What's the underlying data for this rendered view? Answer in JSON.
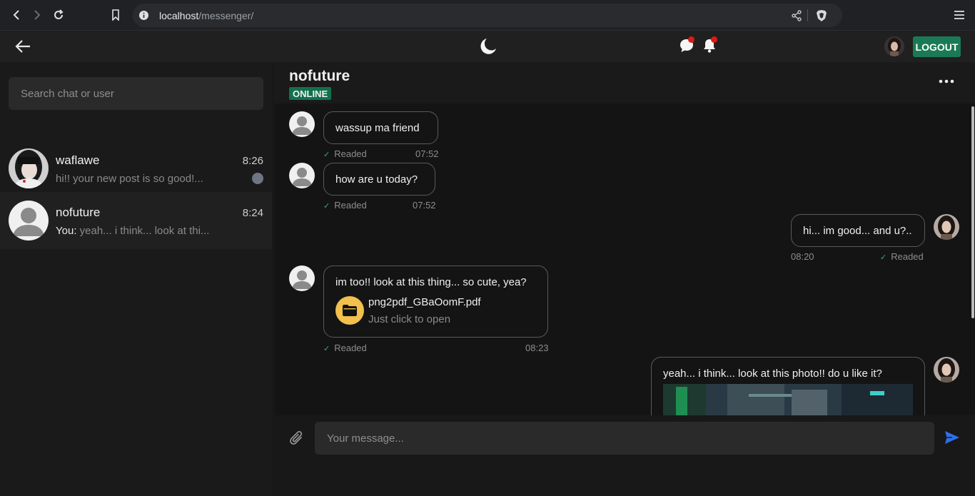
{
  "browser": {
    "url_host": "localhost",
    "url_path": "/messenger/"
  },
  "header": {
    "logout_label": "LOGOUT"
  },
  "sidebar": {
    "search_placeholder": "Search chat or user",
    "chats": [
      {
        "name": "waflawe",
        "time": "8:26",
        "preview": "hi!! your new post is so good!..."
      },
      {
        "name": "nofuture",
        "time": "8:24",
        "you_prefix": "You:",
        "preview": " yeah... i think... look at thi..."
      }
    ]
  },
  "conversation": {
    "name": "nofuture",
    "status": "ONLINE",
    "messages": [
      {
        "text": "wassup ma friend",
        "status": "Readed",
        "time": "07:52"
      },
      {
        "text": "how are u today?",
        "status": "Readed",
        "time": "07:52"
      },
      {
        "text": "hi... im good... and u?..",
        "status": "Readed",
        "time": "08:20"
      },
      {
        "text": "im too!! look at this thing... so cute, yea?",
        "file_name": "png2pdf_GBaOomF.pdf",
        "file_hint": "Just click to open",
        "status": "Readed",
        "time": "08:23"
      },
      {
        "text": "yeah... i think... look at this photo!! do u like it?"
      }
    ]
  },
  "composer": {
    "placeholder": "Your message..."
  },
  "colors": {
    "accent_green": "#1a7a55",
    "send_blue": "#2f6fe8",
    "file_yellow": "#f1c04d",
    "notif_red": "#e01818"
  }
}
